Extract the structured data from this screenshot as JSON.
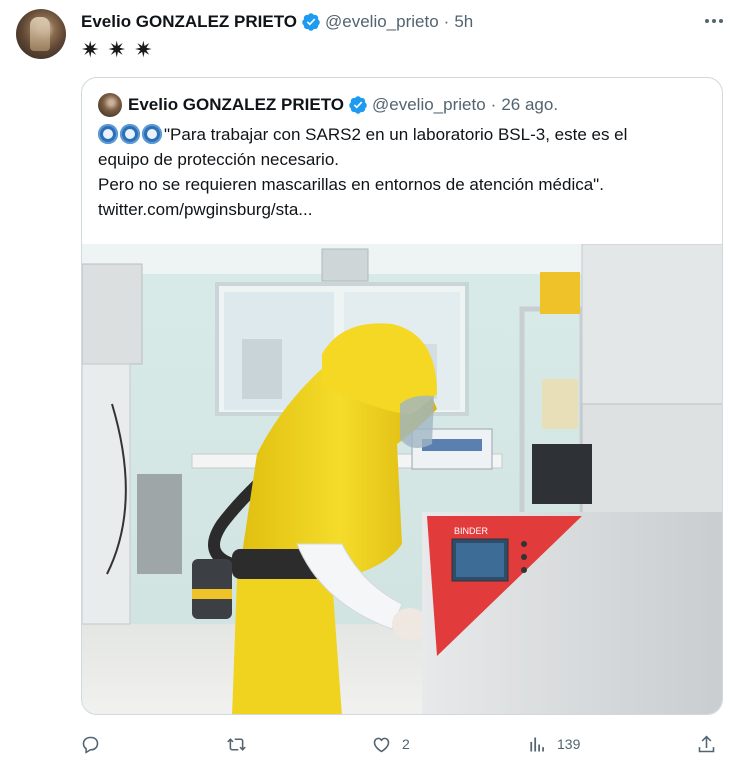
{
  "tweet": {
    "author_name": "Evelio GONZALEZ PRIETO",
    "handle": "@evelio_prieto",
    "separator": "·",
    "time": "5h",
    "text": "✷ ✷ ✷"
  },
  "quoted": {
    "author_name": "Evelio GONZALEZ PRIETO",
    "handle": "@evelio_prieto",
    "separator": "·",
    "date": "26 ago.",
    "lines": [
      "\"Para trabajar con SARS2 en un laboratorio BSL-3, este es el",
      "equipo de protección necesario.",
      "Pero no se requieren mascarillas en entornos de atención médica\".",
      "twitter.com/pwginsburg/sta..."
    ],
    "image_label": "BINDER"
  },
  "actions": {
    "reply_count": "",
    "retweet_count": "",
    "like_count": "2",
    "views_count": "139"
  },
  "colors": {
    "verified": "#1d9bf0",
    "suit": "#f2d21a",
    "incubator_panel": "#e23b3b"
  }
}
